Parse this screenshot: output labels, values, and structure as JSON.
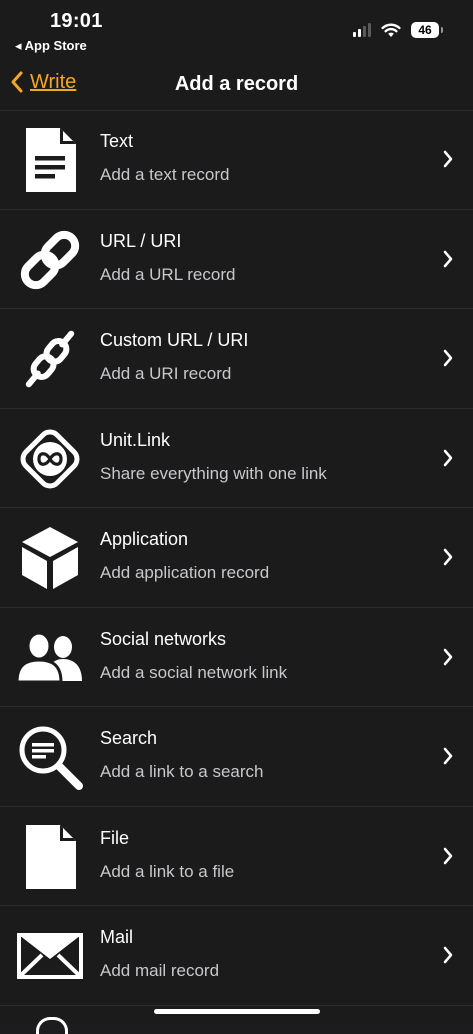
{
  "status_bar": {
    "time": "19:01",
    "back_app": "◂ App Store",
    "battery": "46"
  },
  "nav": {
    "back_label": "Write",
    "title": "Add a record"
  },
  "accent_color": "#f5a623",
  "records": [
    {
      "icon": "document-icon",
      "title": "Text",
      "subtitle": "Add a text record"
    },
    {
      "icon": "link-icon",
      "title": "URL / URI",
      "subtitle": "Add a URL record"
    },
    {
      "icon": "custom-link-icon",
      "title": "Custom URL / URI",
      "subtitle": "Add a URI record"
    },
    {
      "icon": "unit-link-icon",
      "title": "Unit.Link",
      "subtitle": "Share everything with one link"
    },
    {
      "icon": "cube-icon",
      "title": "Application",
      "subtitle": "Add application record"
    },
    {
      "icon": "people-icon",
      "title": "Social networks",
      "subtitle": "Add a social network link"
    },
    {
      "icon": "search-icon",
      "title": "Search",
      "subtitle": "Add a link to a search"
    },
    {
      "icon": "file-icon",
      "title": "File",
      "subtitle": "Add a link to a file"
    },
    {
      "icon": "mail-icon",
      "title": "Mail",
      "subtitle": "Add mail record"
    }
  ]
}
